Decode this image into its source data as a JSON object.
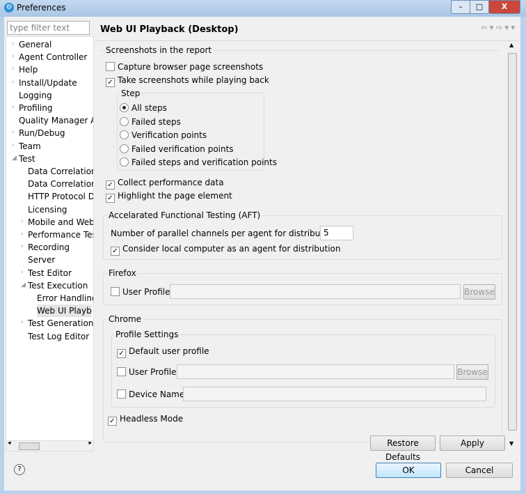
{
  "window": {
    "title": "Preferences",
    "minimize": "–",
    "maximize": "□",
    "close": "X"
  },
  "filter": {
    "placeholder": "type filter text"
  },
  "tree": [
    {
      "label": "General",
      "level": 0,
      "twisty": "›"
    },
    {
      "label": "Agent Controller",
      "level": 0,
      "twisty": "›"
    },
    {
      "label": "Help",
      "level": 0,
      "twisty": "›"
    },
    {
      "label": "Install/Update",
      "level": 0,
      "twisty": "›"
    },
    {
      "label": "Logging",
      "level": 0,
      "twisty": ""
    },
    {
      "label": "Profiling",
      "level": 0,
      "twisty": "›"
    },
    {
      "label": "Quality Manager A",
      "level": 0,
      "twisty": ""
    },
    {
      "label": "Run/Debug",
      "level": 0,
      "twisty": "›"
    },
    {
      "label": "Team",
      "level": 0,
      "twisty": "›"
    },
    {
      "label": "Test",
      "level": 0,
      "twisty": "◢"
    },
    {
      "label": "Data Correlation",
      "level": 1,
      "twisty": ""
    },
    {
      "label": "Data Correlation",
      "level": 1,
      "twisty": ""
    },
    {
      "label": "HTTP Protocol D",
      "level": 1,
      "twisty": ""
    },
    {
      "label": "Licensing",
      "level": 1,
      "twisty": ""
    },
    {
      "label": "Mobile and Web",
      "level": 1,
      "twisty": "›"
    },
    {
      "label": "Performance Tes",
      "level": 1,
      "twisty": "›"
    },
    {
      "label": "Recording",
      "level": 1,
      "twisty": "›"
    },
    {
      "label": "Server",
      "level": 1,
      "twisty": ""
    },
    {
      "label": "Test Editor",
      "level": 1,
      "twisty": "›"
    },
    {
      "label": "Test Execution",
      "level": 1,
      "twisty": "◢"
    },
    {
      "label": "Error Handling",
      "level": 2,
      "twisty": ""
    },
    {
      "label": "Web UI Playb",
      "level": 2,
      "twisty": "",
      "selected": true
    },
    {
      "label": "Test Generation",
      "level": 1,
      "twisty": "›"
    },
    {
      "label": "Test Log Editor",
      "level": 1,
      "twisty": ""
    }
  ],
  "header": {
    "title": "Web UI Playback (Desktop)",
    "nav": "⇦ ▾ ⇨ ▾ ▾"
  },
  "screenshots": {
    "title": "Screenshots in the report",
    "capture": {
      "label": "Capture browser page screenshots",
      "checked": false
    },
    "take": {
      "label": "Take screenshots while playing back",
      "checked": true
    },
    "step_title": "Step",
    "steps": [
      {
        "label": "All steps",
        "selected": true
      },
      {
        "label": "Failed steps",
        "selected": false
      },
      {
        "label": "Verification points",
        "selected": false
      },
      {
        "label": "Failed verification points",
        "selected": false
      },
      {
        "label": "Failed steps and verification points",
        "selected": false
      }
    ],
    "collect": {
      "label": "Collect performance data",
      "checked": true
    },
    "highlight": {
      "label": "Highlight the page element",
      "checked": true
    }
  },
  "aft": {
    "title": "Accelarated Functional Testing (AFT)",
    "channels_label": "Number of parallel channels per agent for distribution",
    "channels_value": "5",
    "local": {
      "label": "Consider local computer as an agent for distribution",
      "checked": true
    }
  },
  "firefox": {
    "title": "Firefox",
    "user_profile": "User Profile:",
    "browse": "Browse"
  },
  "chrome": {
    "title": "Chrome",
    "profile_settings": "Profile Settings",
    "default_profile": "Default user profile",
    "user_profile": "User Profile:",
    "browse": "Browse",
    "device_name": "Device Name:",
    "headless": "Headless Mode"
  },
  "buttons": {
    "restore": "Restore Defaults",
    "apply": "Apply",
    "ok": "OK",
    "cancel": "Cancel",
    "help": "?"
  }
}
